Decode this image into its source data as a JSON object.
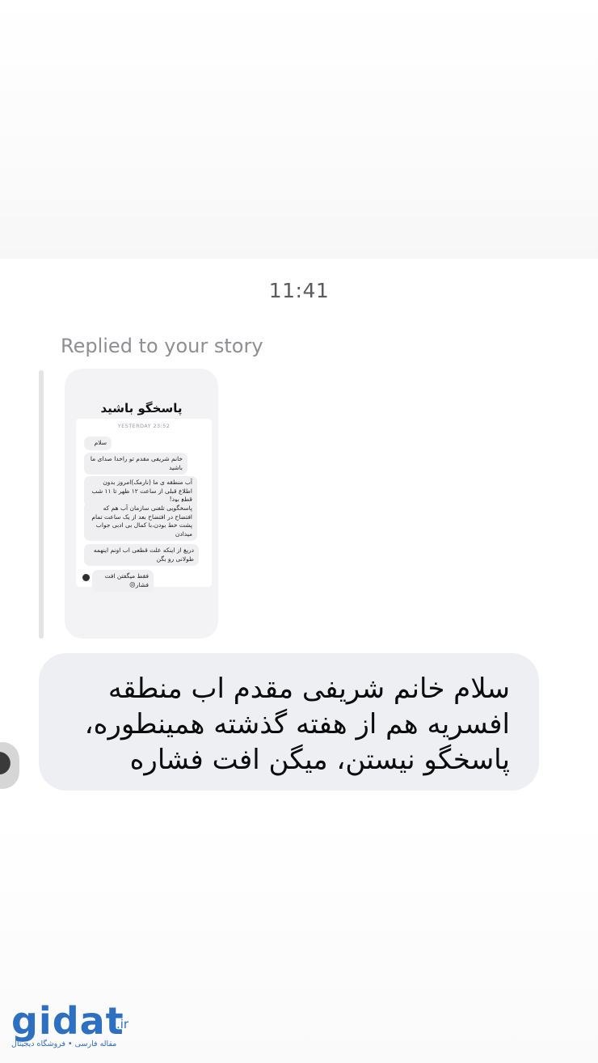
{
  "thread": {
    "timestamp": "11:41",
    "replied_label": "Replied to your story"
  },
  "story": {
    "title": "پاسخگو باشید",
    "header_time": "YESTERDAY 23:52",
    "messages": [
      "سلام",
      "خانم شریفی مقدم تو راخدا صدای ما باشید",
      "آب منطقه ی ما (نارمک)امروز بدون اطلاع قبلی از ساعت ۱۲ ظهر تا ۱۱ شب قطع بود!",
      "پاسخگویی تلفنی سازمان آب هم که افتضاح در افتضاح بعد از یک ساعت تمام پشت خط بودن،با کمال بی ادبی جواب میدادن",
      "دریغ از اینکه علت قطعی اب اونم اینهمه طولانی رو بگن",
      "فقط میگفتن افت فشار😒"
    ]
  },
  "message": {
    "text": "سلام خانم شریفی مقدم اب منطقه افسریه هم از هفته گذشته همینطوره، پاسخگو نیستن، میگن افت فشاره"
  },
  "watermark": {
    "logo": "gidat",
    "tld": ".ir",
    "subtitle": "مقاله فارسی • فروشگاه دیجیتال"
  }
}
